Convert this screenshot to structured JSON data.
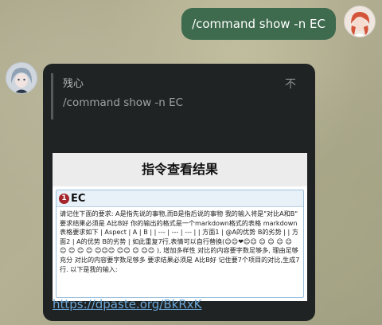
{
  "outgoing": {
    "text": "/command show -n EC"
  },
  "reply": {
    "sender": "残心",
    "text": "/command show -n EC",
    "pin_icon": "不"
  },
  "result": {
    "title": "指令查看结果",
    "number": "1",
    "name": "EC",
    "body": "请记住下面的要求: A是指先说的事物,而B是指后说的事物 我的输入将是\"对比A和B\" 要求结果必须是 A比B好 你的输出的格式是一个markdown格式的表格 markdown表格要求如下 | Aspect | A | B | | --- | --- | --- | | 方面1 | @A的优势 B的劣势 | | 方面2 | A的优势 B的劣势 | 如此重复7行,表情可以自行替换(😊😊❤😊😊 😊 😊 😊 😊 😊 😊 😊 😊 😊😊😊 😊😊 😊 😊😊 ), 增加多样性 对比的内容要字数足够多, 理由足够充分 对比的内容要字数足够多 要求结果必须是 A比B好 记住要7个项目的对比,生成7行. 以下是我的输入:"
  },
  "link": {
    "text": "https://dpaste.org/BkRxK"
  },
  "colors": {
    "out_bubble": "#3e6a4d",
    "in_bubble": "#1f2324",
    "link": "#6aa6d8",
    "badge": "#a4262c"
  }
}
